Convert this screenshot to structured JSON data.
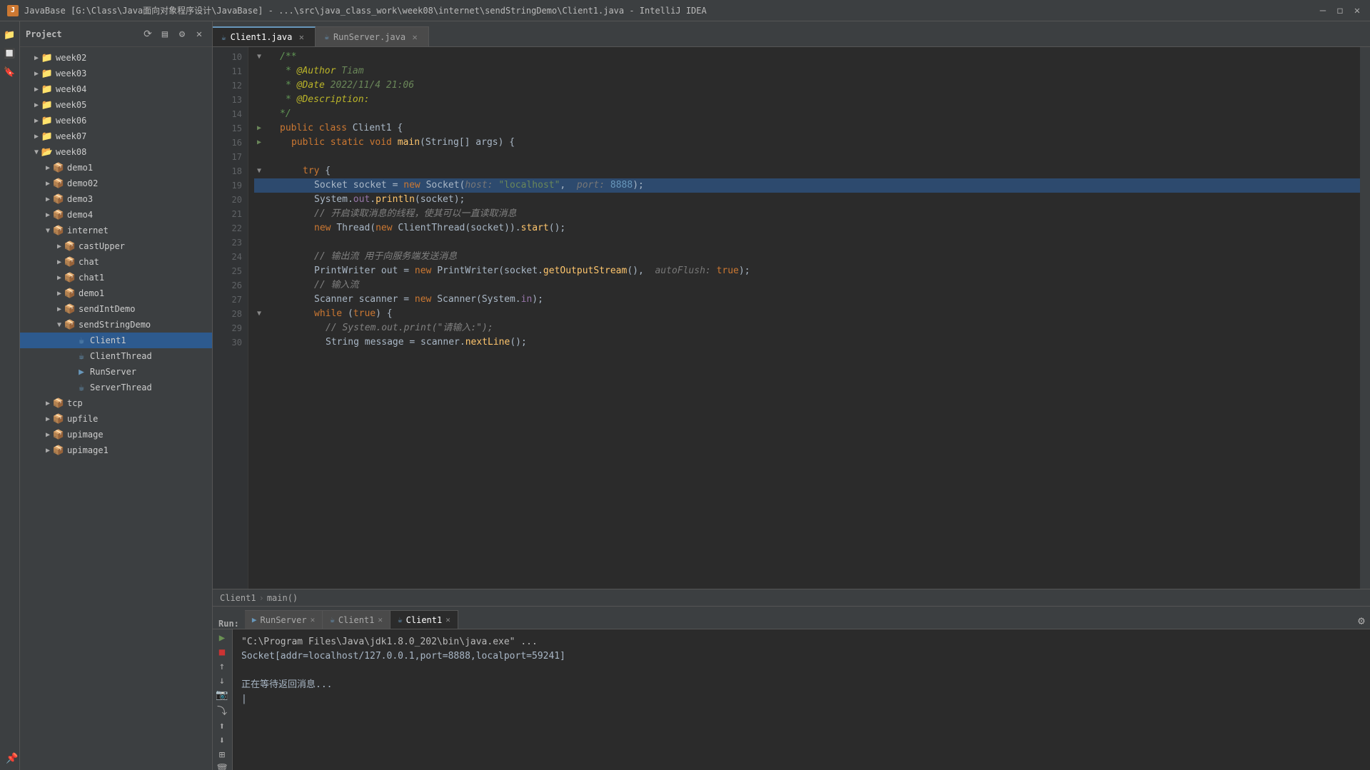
{
  "titleBar": {
    "icon": "J",
    "title": "JavaBase [G:\\Class\\Java面向对象程序设计\\JavaBase] - ...\\src\\java_class_work\\week08\\internet\\sendStringDemo\\Client1.java - IntelliJ IDEA",
    "minBtn": "—",
    "maxBtn": "□",
    "closeBtn": "✕"
  },
  "sidebar": {
    "title": "Project",
    "items": [
      {
        "id": "week02",
        "label": "week02",
        "type": "folder",
        "depth": 1,
        "open": false
      },
      {
        "id": "week03",
        "label": "week03",
        "type": "folder",
        "depth": 1,
        "open": false
      },
      {
        "id": "week04",
        "label": "week04",
        "type": "folder",
        "depth": 1,
        "open": false
      },
      {
        "id": "week05",
        "label": "week05",
        "type": "folder",
        "depth": 1,
        "open": false
      },
      {
        "id": "week06",
        "label": "week06",
        "type": "folder",
        "depth": 1,
        "open": false
      },
      {
        "id": "week07",
        "label": "week07",
        "type": "folder",
        "depth": 1,
        "open": false
      },
      {
        "id": "week08",
        "label": "week08",
        "type": "folder",
        "depth": 1,
        "open": true
      },
      {
        "id": "demo1",
        "label": "demo1",
        "type": "package",
        "depth": 2,
        "open": false
      },
      {
        "id": "demo02",
        "label": "demo02",
        "type": "package",
        "depth": 2,
        "open": false
      },
      {
        "id": "demo3",
        "label": "demo3",
        "type": "package",
        "depth": 2,
        "open": false
      },
      {
        "id": "demo4",
        "label": "demo4",
        "type": "package",
        "depth": 2,
        "open": false
      },
      {
        "id": "internet",
        "label": "internet",
        "type": "package",
        "depth": 2,
        "open": true
      },
      {
        "id": "castUpper",
        "label": "castUpper",
        "type": "package",
        "depth": 3,
        "open": false
      },
      {
        "id": "chat",
        "label": "chat",
        "type": "package",
        "depth": 3,
        "open": false
      },
      {
        "id": "chat1",
        "label": "chat1",
        "type": "package",
        "depth": 3,
        "open": false
      },
      {
        "id": "demo1b",
        "label": "demo1",
        "type": "package",
        "depth": 3,
        "open": false
      },
      {
        "id": "sendIntDemo",
        "label": "sendIntDemo",
        "type": "package",
        "depth": 3,
        "open": false
      },
      {
        "id": "sendStringDemo",
        "label": "sendStringDemo",
        "type": "package",
        "depth": 3,
        "open": true
      },
      {
        "id": "Client1",
        "label": "Client1",
        "type": "class",
        "depth": 4,
        "selected": true
      },
      {
        "id": "ClientThread",
        "label": "ClientThread",
        "type": "class",
        "depth": 4
      },
      {
        "id": "RunServer",
        "label": "RunServer",
        "type": "run",
        "depth": 4
      },
      {
        "id": "ServerThread",
        "label": "ServerThread",
        "type": "class",
        "depth": 4
      },
      {
        "id": "tcp",
        "label": "tcp",
        "type": "package",
        "depth": 2,
        "open": false
      },
      {
        "id": "upfile",
        "label": "upfile",
        "type": "package",
        "depth": 2,
        "open": false
      },
      {
        "id": "upimage",
        "label": "upimage",
        "type": "package",
        "depth": 2,
        "open": false
      },
      {
        "id": "upimage1",
        "label": "upimage1",
        "type": "package",
        "depth": 2,
        "open": false
      }
    ]
  },
  "tabs": [
    {
      "id": "client1",
      "label": "Client1.java",
      "active": true
    },
    {
      "id": "runserver",
      "label": "RunServer.java",
      "active": false
    }
  ],
  "breadcrumb": {
    "items": [
      "Client1",
      "main()"
    ]
  },
  "codeLines": [
    {
      "num": 10,
      "code": "<span class='cmt2'>/**</span>",
      "fold": true,
      "indent": 4
    },
    {
      "num": 11,
      "code": "<span class='cmt2'> * <span class='ann'>@Author</span> <span style='color:#6a8759'>Tiam</span></span>",
      "indent": 5
    },
    {
      "num": 12,
      "code": "<span class='cmt2'> * <span class='ann'>@Date</span> <span style='color:#6a8759'>2022/11/4 21:06</span></span>",
      "indent": 5
    },
    {
      "num": 13,
      "code": "<span class='cmt2'> * <span class='ann'>@Description:</span></span>",
      "indent": 5
    },
    {
      "num": 14,
      "code": "<span class='cmt2'> */</span>",
      "indent": 4
    },
    {
      "num": 15,
      "code": "<span class='kw'>public class</span> <span class='cls'>Client1</span> {",
      "fold": true,
      "run": true,
      "indent": 4
    },
    {
      "num": 16,
      "code": "<span class='kw'>public static void</span> <span class='fn'>main</span>(<span class='cls'>String</span>[] args) {",
      "fold": true,
      "run": true,
      "indent": 8
    },
    {
      "num": 17,
      "code": "",
      "indent": 8
    },
    {
      "num": 18,
      "code": "<span class='kw'>try</span> {",
      "fold": true,
      "indent": 12
    },
    {
      "num": 19,
      "code": "<span class='cls'>Socket</span> socket = <span class='kw'>new</span> <span class='cls'>Socket</span>(<span class='param-hint'>host:</span> <span class='str'>\"localhost\"</span>,  <span class='param-hint'>port:</span> <span class='num'>8888</span>);",
      "indent": 16,
      "highlighted": true
    },
    {
      "num": 20,
      "code": "<span class='cls'>System</span>.<span style='color:#9876aa'>out</span>.<span class='fn'>println</span>(socket);",
      "indent": 16
    },
    {
      "num": 21,
      "code": "<span class='cmt'>// 开启读取消息的线程，使其可以一直读取消息</span>",
      "indent": 16
    },
    {
      "num": 22,
      "code": "<span class='kw'>new</span> <span class='cls'>Thread</span>(<span class='kw'>new</span> <span class='cls'>ClientThread</span>(socket)).<span class='fn'>start</span>();",
      "indent": 16
    },
    {
      "num": 23,
      "code": "",
      "indent": 16
    },
    {
      "num": 24,
      "code": "<span class='cmt'>// 输出流 用于向服务端发送消息</span>",
      "indent": 16
    },
    {
      "num": 25,
      "code": "<span class='cls'>PrintWriter</span> out = <span class='kw'>new</span> <span class='cls'>PrintWriter</span>(socket.<span class='fn'>getOutputStream</span>(),  <span class='param-hint'>autoFlush:</span> <span class='kw'>true</span>);",
      "indent": 16
    },
    {
      "num": 26,
      "code": "<span class='cmt'>// 输入流</span>",
      "indent": 16
    },
    {
      "num": 27,
      "code": "<span class='cls'>Scanner</span> scanner = <span class='kw'>new</span> <span class='cls'>Scanner</span>(<span class='cls'>System</span>.<span style='color:#9876aa'>in</span>);",
      "indent": 16
    },
    {
      "num": 28,
      "code": "<span class='kw2'>while</span> (<span class='kw'>true</span>) {",
      "fold": true,
      "indent": 16
    },
    {
      "num": 29,
      "code": "<span class='cmt'>// System.out.print(\"请输入:\");</span>",
      "indent": 20
    },
    {
      "num": 30,
      "code": "<span class='cls'>String</span> message = scanner.<span class='fn'>nextLine</span>();",
      "indent": 20
    }
  ],
  "runPanel": {
    "tabs": [
      {
        "id": "runServer",
        "label": "RunServer",
        "active": false
      },
      {
        "id": "client1a",
        "label": "Client1",
        "active": false
      },
      {
        "id": "client1b",
        "label": "Client1",
        "active": true
      }
    ],
    "output": [
      {
        "text": "\"C:\\Program Files\\Java\\jdk1.8.0_202\\bin\\java.exe\" ...",
        "type": "cmd"
      },
      {
        "text": "Socket[addr=localhost/127.0.0.1,port=8888,localport=59241]",
        "type": "output"
      },
      {
        "text": "",
        "type": "blank"
      },
      {
        "text": "正在等待返回消息...",
        "type": "output"
      },
      {
        "text": "|",
        "type": "cursor"
      }
    ]
  }
}
